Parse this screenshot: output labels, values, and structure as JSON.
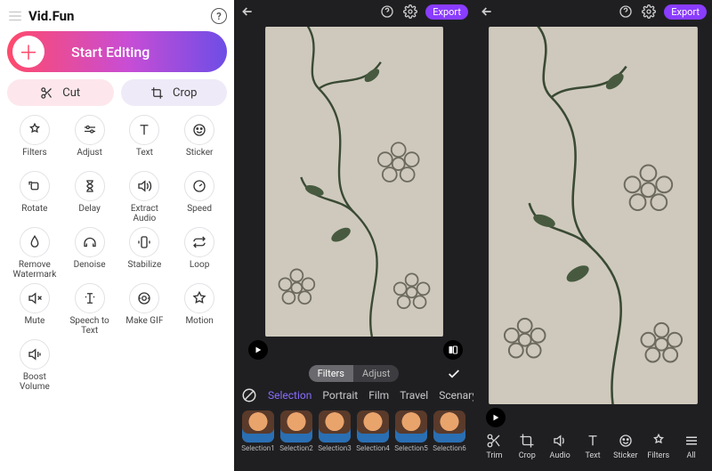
{
  "left": {
    "brand": "Vid.Fun",
    "start": "Start Editing",
    "cut": "Cut",
    "crop": "Crop",
    "tools": [
      {
        "id": "filters",
        "label": "Filters"
      },
      {
        "id": "adjust",
        "label": "Adjust"
      },
      {
        "id": "text",
        "label": "Text"
      },
      {
        "id": "sticker",
        "label": "Sticker"
      },
      {
        "id": "rotate",
        "label": "Rotate"
      },
      {
        "id": "delay",
        "label": "Delay"
      },
      {
        "id": "extract-audio",
        "label": "Extract Audio"
      },
      {
        "id": "speed",
        "label": "Speed"
      },
      {
        "id": "remove-watermark",
        "label": "Remove Watermark"
      },
      {
        "id": "denoise",
        "label": "Denoise"
      },
      {
        "id": "stabilize",
        "label": "Stabilize"
      },
      {
        "id": "loop",
        "label": "Loop"
      },
      {
        "id": "mute",
        "label": "Mute"
      },
      {
        "id": "speech-to-text",
        "label": "Speech to Text"
      },
      {
        "id": "make-gif",
        "label": "Make GIF"
      },
      {
        "id": "motion",
        "label": "Motion"
      },
      {
        "id": "boost-volume",
        "label": "Boost Volume"
      }
    ]
  },
  "mid": {
    "export": "Export",
    "segment": {
      "filters": "Filters",
      "adjust": "Adjust",
      "active": "filters"
    },
    "categories": [
      "Selection",
      "Portrait",
      "Film",
      "Travel",
      "Scenary"
    ],
    "active_category": "Selection",
    "thumbs": [
      "Selection1",
      "Selection2",
      "Selection3",
      "Selection4",
      "Selection5",
      "Selection6"
    ]
  },
  "right": {
    "export": "Export",
    "toolbar": [
      {
        "id": "trim",
        "label": "Trim"
      },
      {
        "id": "crop",
        "label": "Crop"
      },
      {
        "id": "audio",
        "label": "Audio"
      },
      {
        "id": "text",
        "label": "Text"
      },
      {
        "id": "sticker",
        "label": "Sticker"
      },
      {
        "id": "filters",
        "label": "Filters"
      },
      {
        "id": "all",
        "label": "All"
      }
    ]
  }
}
